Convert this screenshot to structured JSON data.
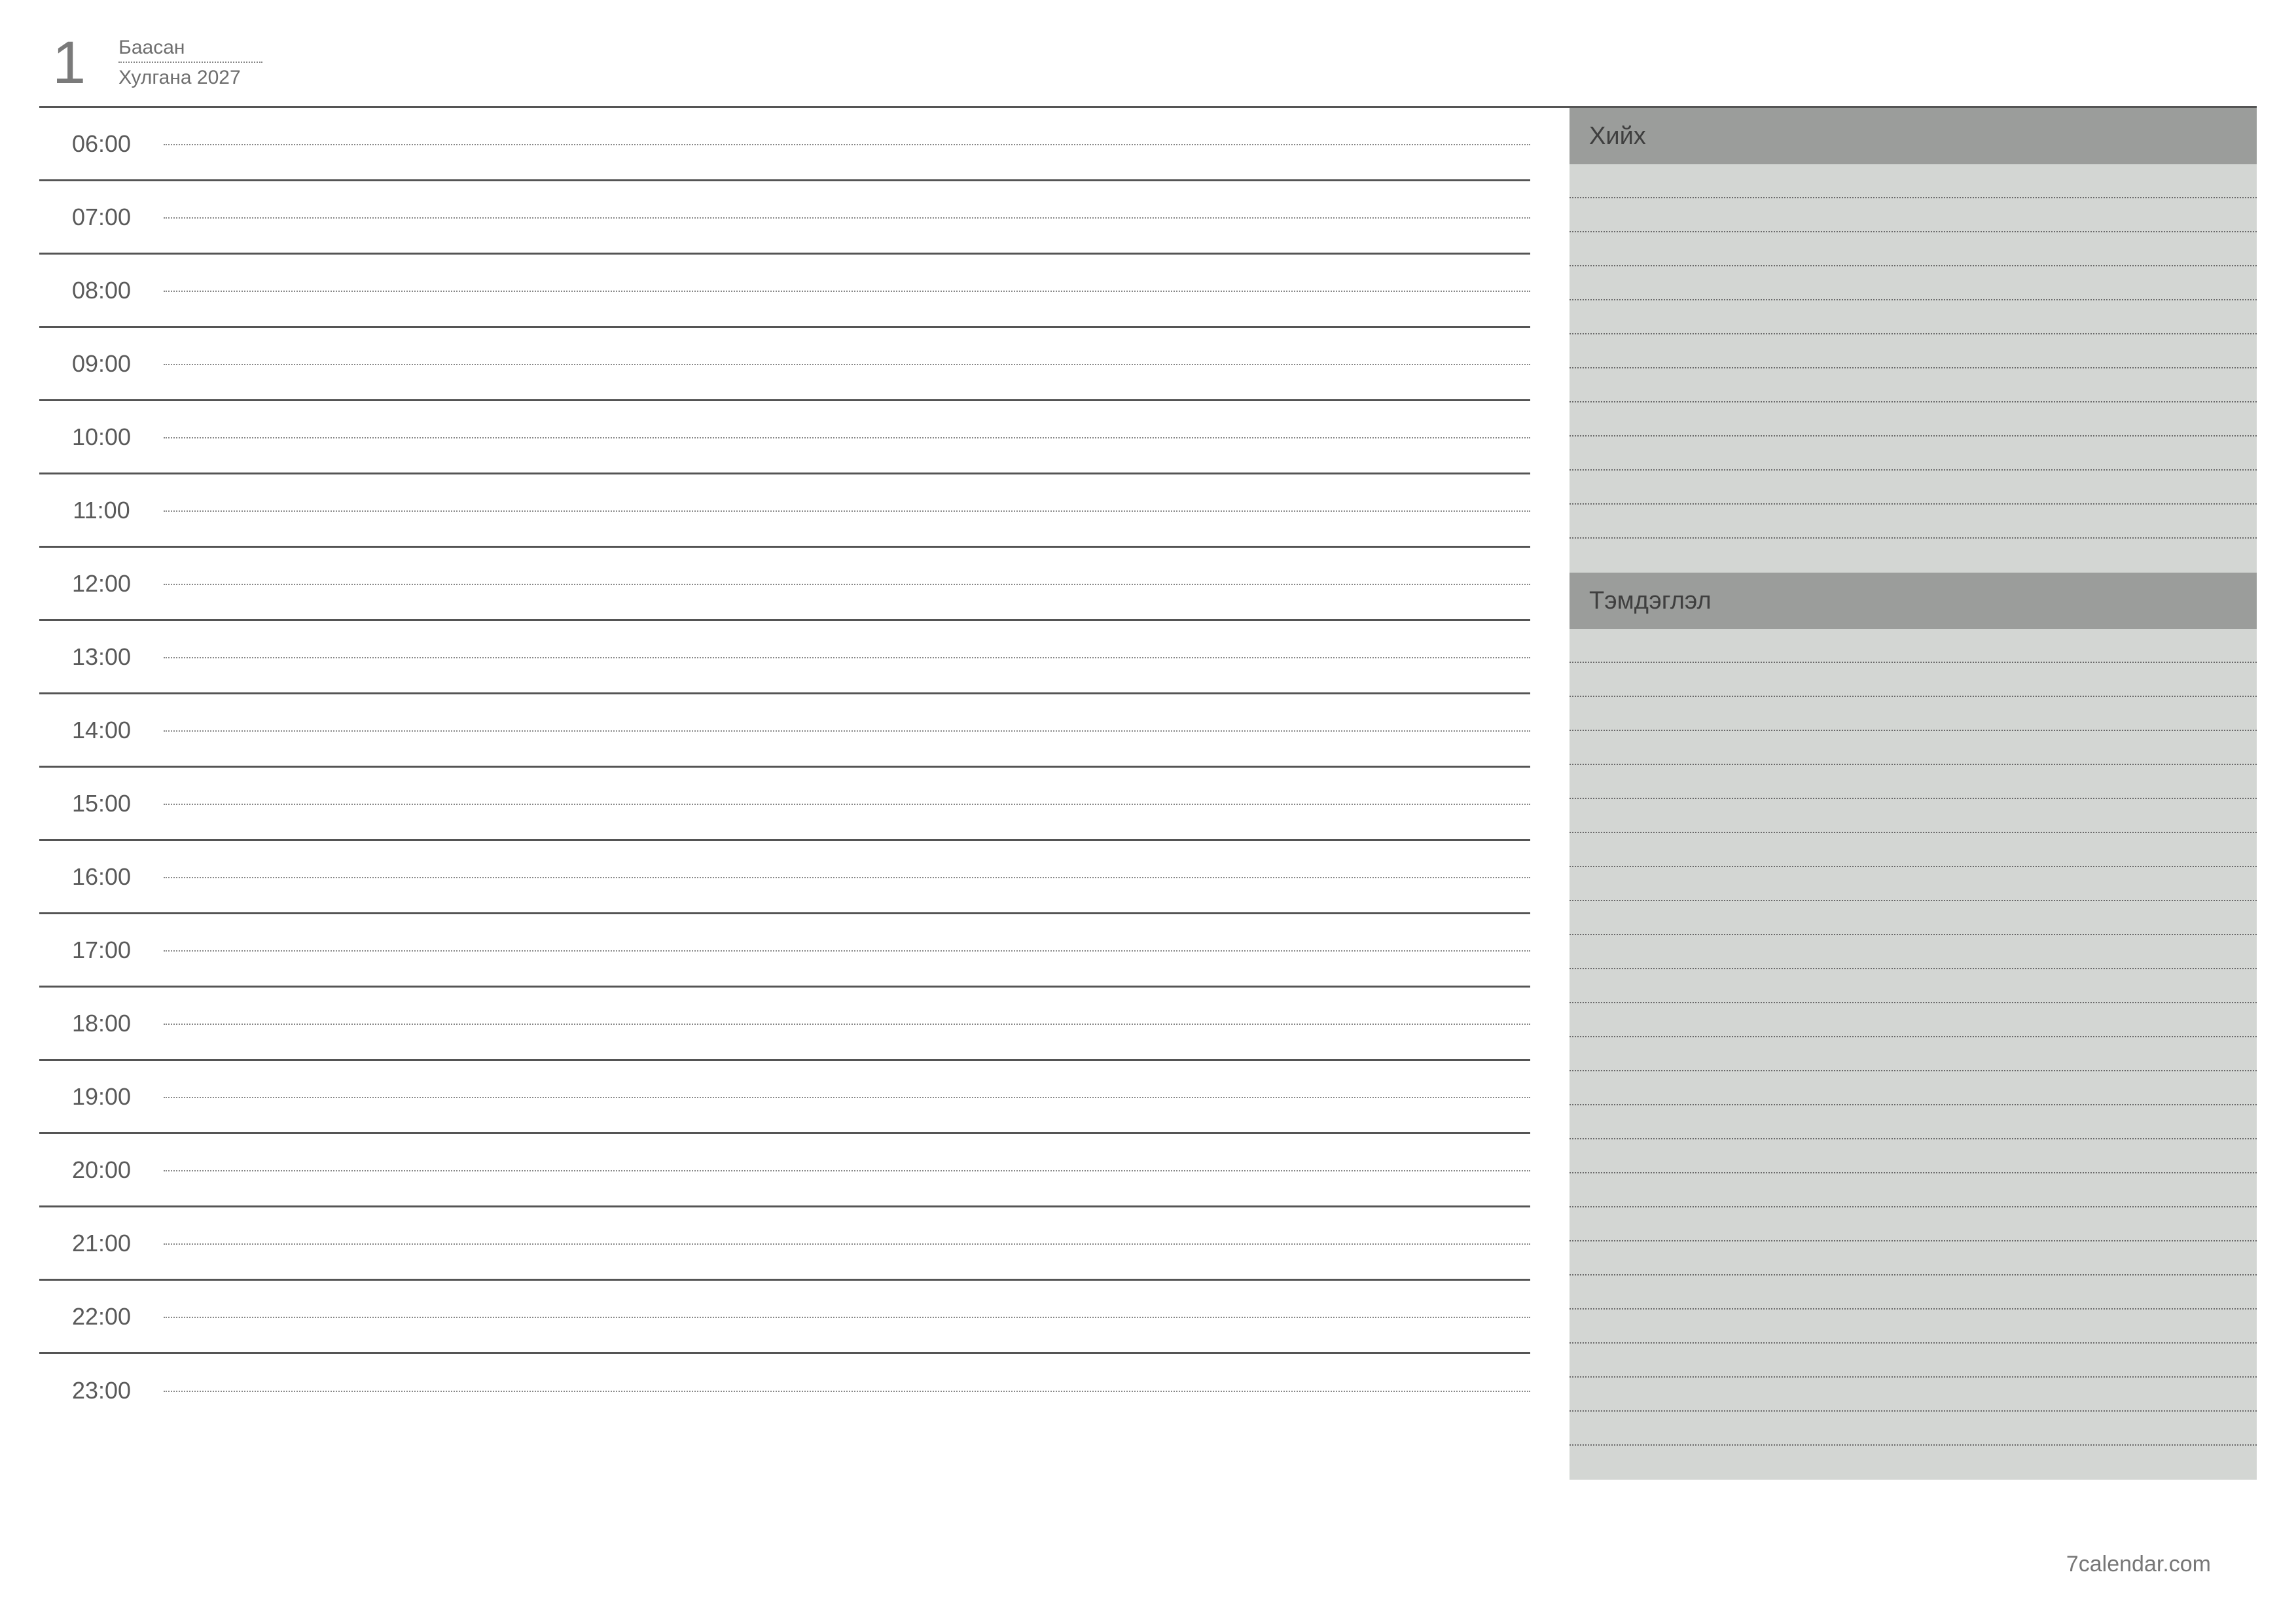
{
  "header": {
    "day_number": "1",
    "weekday": "Баасан",
    "month_year": "Хулгана 2027"
  },
  "schedule": {
    "hours": [
      "06:00",
      "07:00",
      "08:00",
      "09:00",
      "10:00",
      "11:00",
      "12:00",
      "13:00",
      "14:00",
      "15:00",
      "16:00",
      "17:00",
      "18:00",
      "19:00",
      "20:00",
      "21:00",
      "22:00",
      "23:00"
    ]
  },
  "side": {
    "todo_label": "Хийх",
    "notes_label": "Тэмдэглэл",
    "todo_lines": 12,
    "notes_lines": 25
  },
  "footer": {
    "credit": "7calendar.com"
  },
  "colors": {
    "side_bg": "#d3d6d3",
    "side_header_bg": "#9b9d9b",
    "rule": "#555555",
    "dotted": "#888888"
  }
}
